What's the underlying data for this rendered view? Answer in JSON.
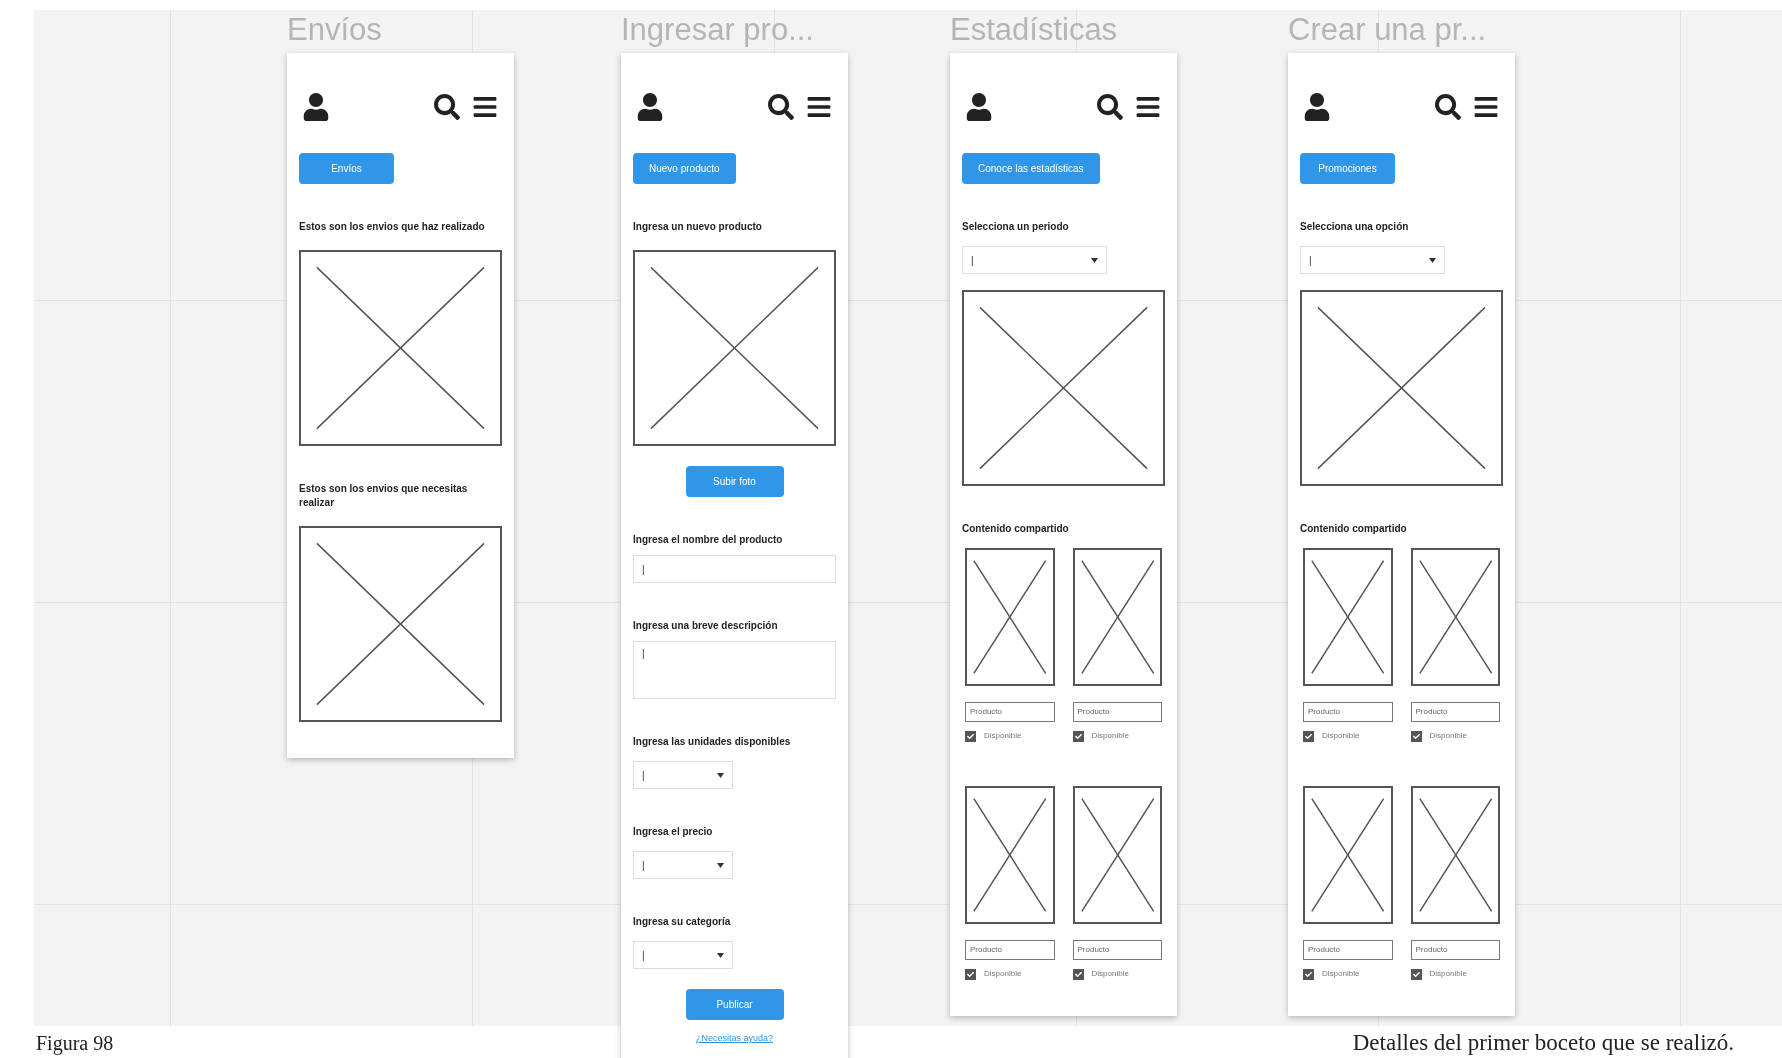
{
  "screens": [
    {
      "title": "Envíos",
      "blocks": [
        {
          "kind": "button",
          "label": "Envíos"
        },
        {
          "kind": "label",
          "text": "Estos son los envios que haz realizado"
        },
        {
          "kind": "image"
        },
        {
          "kind": "label",
          "text": "Estos son los envios que necesitas realizar"
        },
        {
          "kind": "image"
        }
      ]
    },
    {
      "title": "Ingresar pro...",
      "blocks": [
        {
          "kind": "button",
          "label": "Nuevo producto"
        },
        {
          "kind": "label",
          "text": "Ingresa un nuevo producto"
        },
        {
          "kind": "image"
        },
        {
          "kind": "center_button",
          "label": "Subir foto"
        },
        {
          "kind": "label",
          "text": "Ingresa el nombre del producto"
        },
        {
          "kind": "input",
          "value": "|"
        },
        {
          "kind": "label",
          "text": "Ingresa una breve descripción"
        },
        {
          "kind": "textarea",
          "value": "|"
        },
        {
          "kind": "label",
          "text": "Ingresa las unidades disponibles"
        },
        {
          "kind": "select",
          "value": "|"
        },
        {
          "kind": "label",
          "text": "Ingresa el precio"
        },
        {
          "kind": "select",
          "value": "|"
        },
        {
          "kind": "label",
          "text": "Ingresa su categoría"
        },
        {
          "kind": "select",
          "value": "|"
        },
        {
          "kind": "center_button",
          "label": "Publicar"
        },
        {
          "kind": "link",
          "text": "¿Necesitas ayuda?"
        }
      ]
    },
    {
      "title": "Estadísticas",
      "blocks": [
        {
          "kind": "button",
          "label": "Conoce las estadísticas"
        },
        {
          "kind": "label",
          "text": "Selecciona un periodo"
        },
        {
          "kind": "wide_select",
          "value": "|"
        },
        {
          "kind": "image"
        },
        {
          "kind": "label",
          "text": "Contenido compartido"
        },
        {
          "kind": "grid",
          "items": [
            {
              "value": "Producto",
              "checked": true,
              "label": "Disponible"
            },
            {
              "value": "Producto",
              "checked": true,
              "label": "Disponible"
            },
            {
              "value": "Producto",
              "checked": true,
              "label": "Disponible"
            },
            {
              "value": "Producto",
              "checked": true,
              "label": "Disponible"
            }
          ]
        }
      ]
    },
    {
      "title": "Crear una pr...",
      "blocks": [
        {
          "kind": "button",
          "label": "Promociones"
        },
        {
          "kind": "label",
          "text": "Selecciona una opción"
        },
        {
          "kind": "wide_select",
          "value": "|"
        },
        {
          "kind": "image"
        },
        {
          "kind": "label",
          "text": "Contenido compartido"
        },
        {
          "kind": "grid",
          "items": [
            {
              "value": "Producto",
              "checked": true,
              "label": "Disponible"
            },
            {
              "value": "Producto",
              "checked": true,
              "label": "Disponible"
            },
            {
              "value": "Producto",
              "checked": true,
              "label": "Disponible"
            },
            {
              "value": "Producto",
              "checked": true,
              "label": "Disponible"
            }
          ]
        }
      ]
    }
  ],
  "caption_left": "Figura 98",
  "caption_right": "Detalles del primer boceto que se realizó."
}
